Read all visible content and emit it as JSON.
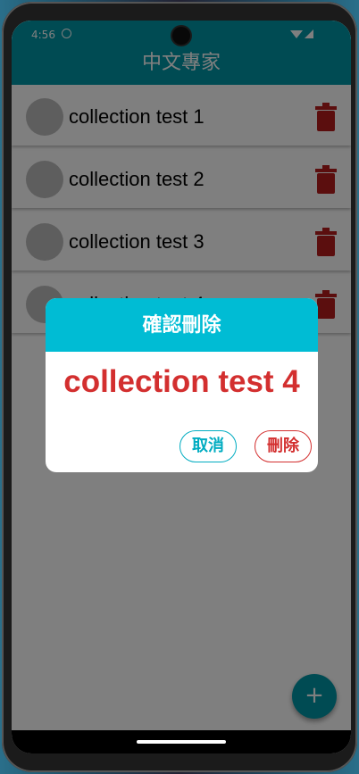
{
  "status": {
    "time": "4:56"
  },
  "appbar": {
    "title": "中文專家"
  },
  "collections": [
    {
      "label": "collection test 1"
    },
    {
      "label": "collection test 2"
    },
    {
      "label": "collection test 3"
    },
    {
      "label": "collection test 4"
    }
  ],
  "dialog": {
    "title": "確認刪除",
    "message": "collection test 4",
    "cancel_label": "取消",
    "delete_label": "刪除"
  },
  "fab": {
    "icon": "plus-icon",
    "label": "+"
  },
  "colors": {
    "primary": "#0097a7",
    "dialog_header": "#00bcd4",
    "danger": "#d32f2f",
    "trash": "#b71c1c"
  }
}
